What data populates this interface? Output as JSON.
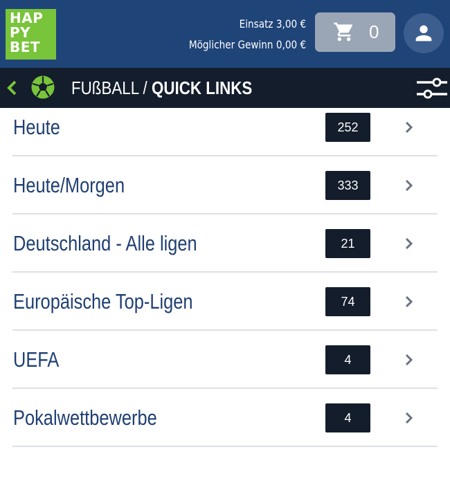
{
  "header": {
    "logo": [
      "HAP",
      "PY",
      "BET"
    ],
    "stake_label": "Einsatz 3,00 €",
    "potential_win_label": "Möglicher Gewinn 0,00 €",
    "cart_count": "0"
  },
  "nav": {
    "sport": "FUßBALL /",
    "section": "QUICK LINKS"
  },
  "items": [
    {
      "label": "Heute",
      "count": "252"
    },
    {
      "label": "Heute/Morgen",
      "count": "333"
    },
    {
      "label": "Deutschland - Alle ligen",
      "count": "21"
    },
    {
      "label": "Europäische Top-Ligen",
      "count": "74"
    },
    {
      "label": "UEFA",
      "count": "4"
    },
    {
      "label": "Pokalwettbewerbe",
      "count": "4"
    }
  ],
  "colors": {
    "header_bg": "#1f4478",
    "navbar_bg": "#141d2b",
    "brand_green": "#78c43a",
    "item_text": "#1f3f73"
  },
  "icons": [
    "cart-icon",
    "user-icon",
    "back-chevron-icon",
    "soccer-ball-icon",
    "filter-sliders-icon",
    "chevron-right-icon"
  ]
}
